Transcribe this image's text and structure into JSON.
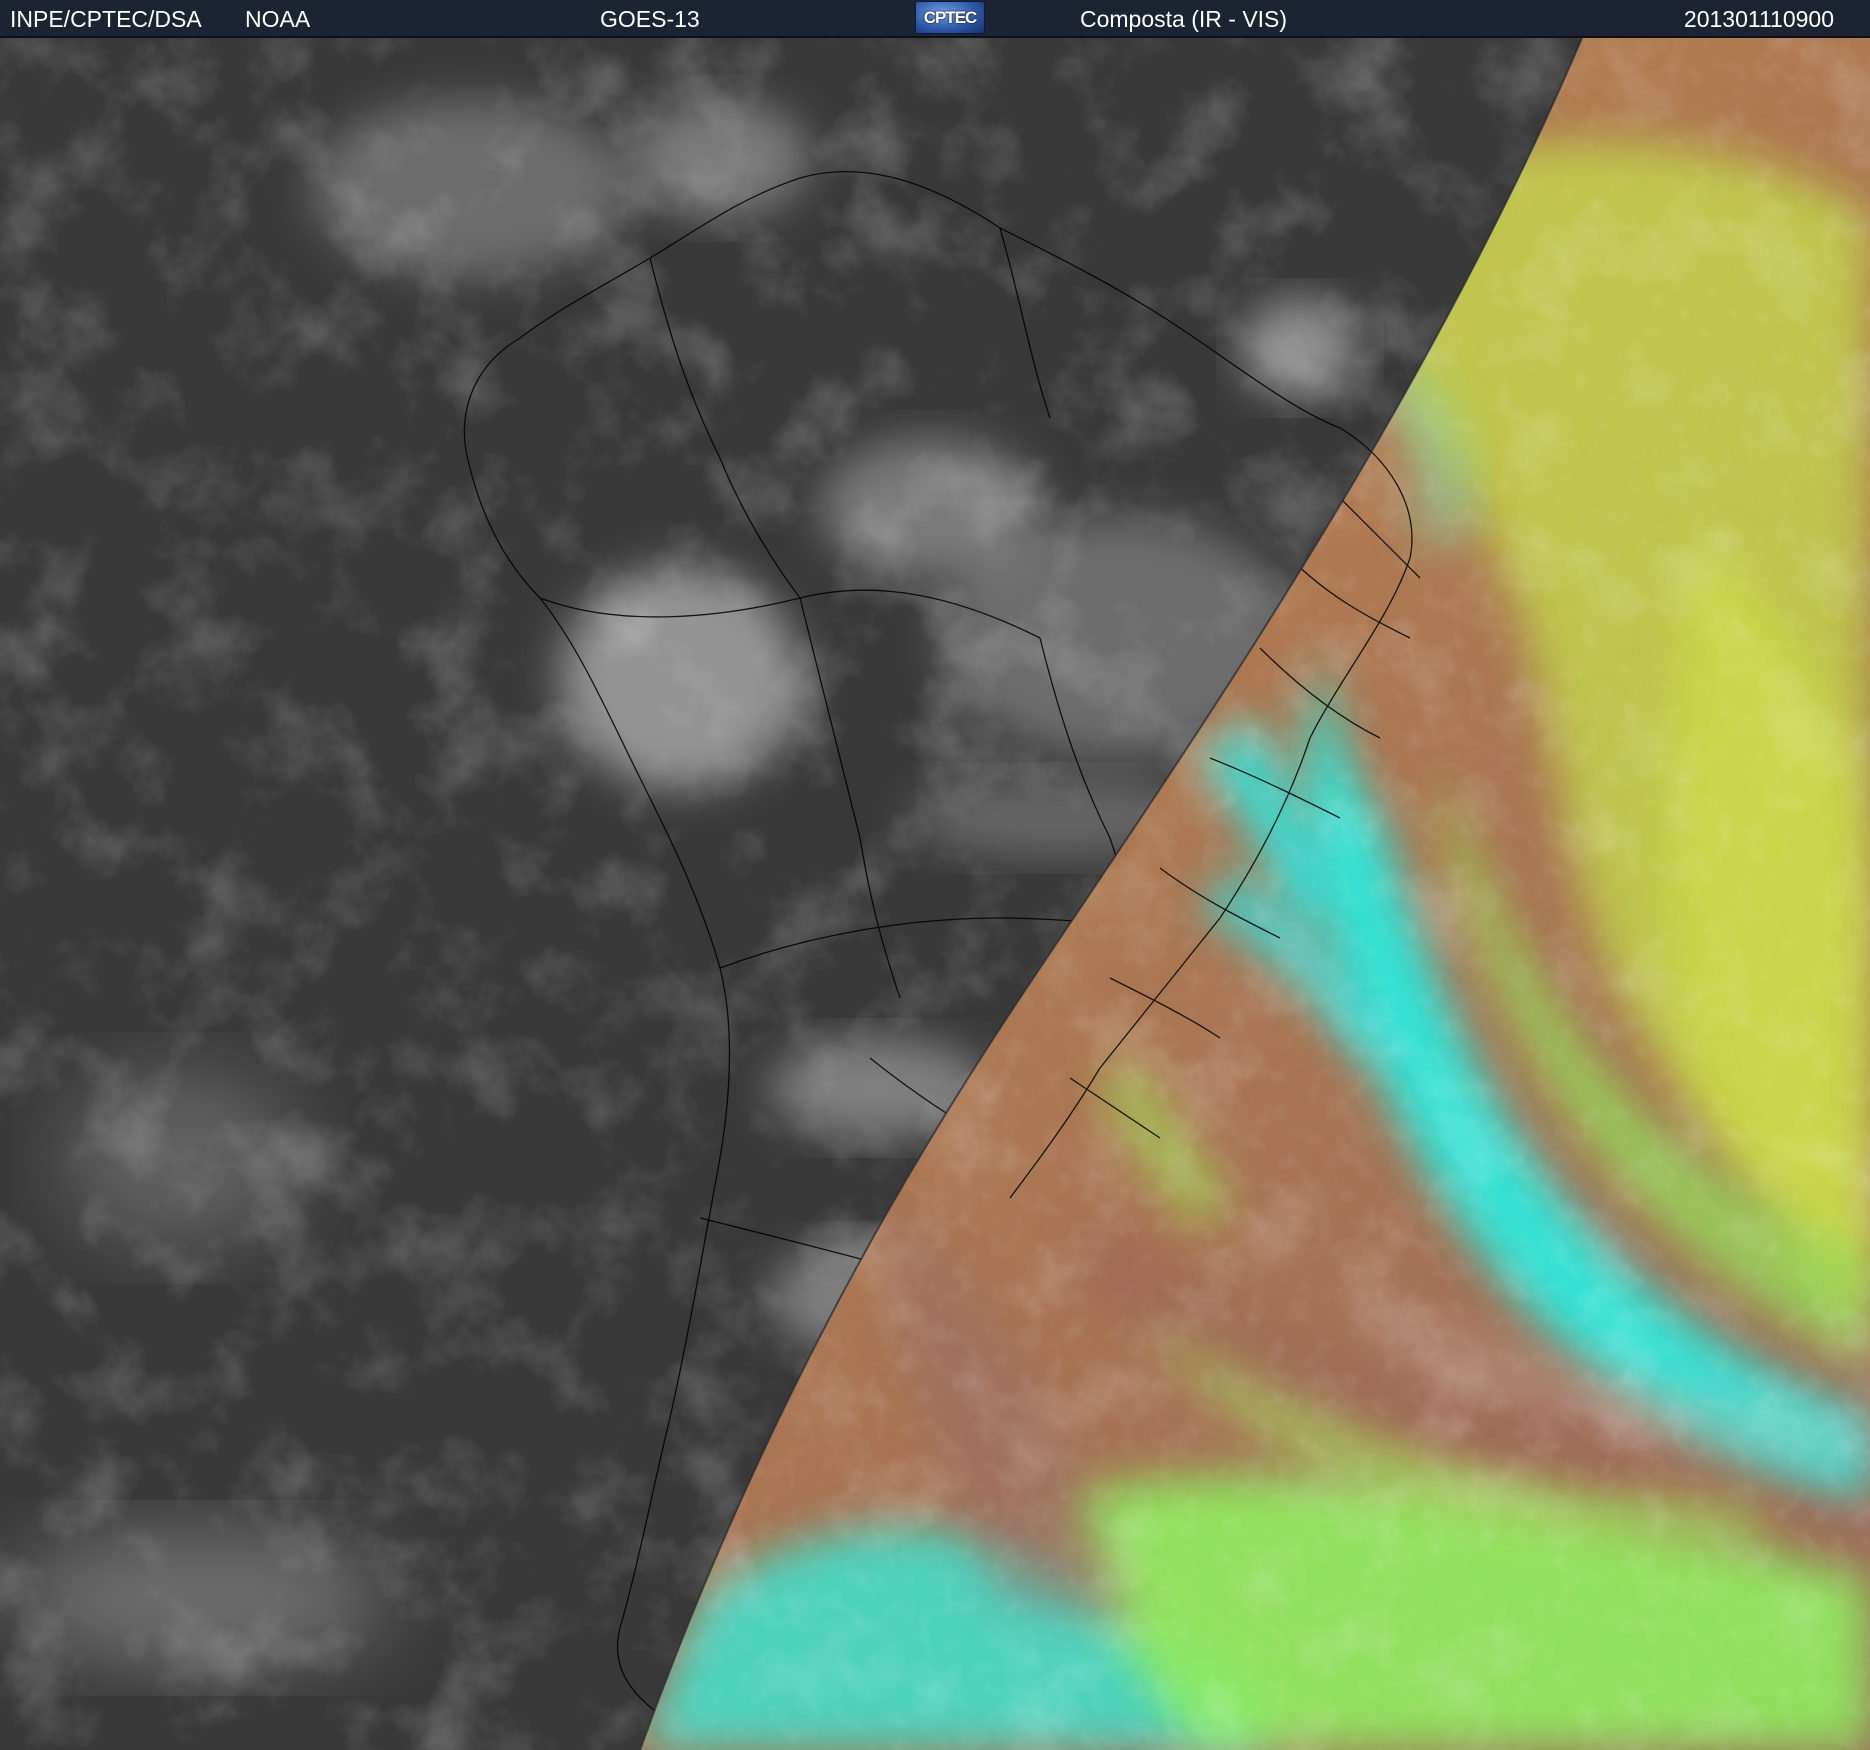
{
  "header": {
    "organization": "INPE/CPTEC/DSA",
    "agency": "NOAA",
    "satellite": "GOES-13",
    "logo_text": "CPTEC",
    "product": "Composta (IR - VIS)",
    "timestamp": "201301110900"
  },
  "imagery": {
    "night_side": "grayscale infrared",
    "day_side": "false-color composite",
    "colors": {
      "night_background": "#3a3a3a",
      "night_cloud": "#d8d8d8",
      "coastline": "#000000",
      "day_rust": "#9a6a52",
      "day_orange": "#c88a45",
      "day_yellow_green": "#c6e04a",
      "day_green": "#8cec5c",
      "day_cyan": "#2ee6dc"
    }
  }
}
